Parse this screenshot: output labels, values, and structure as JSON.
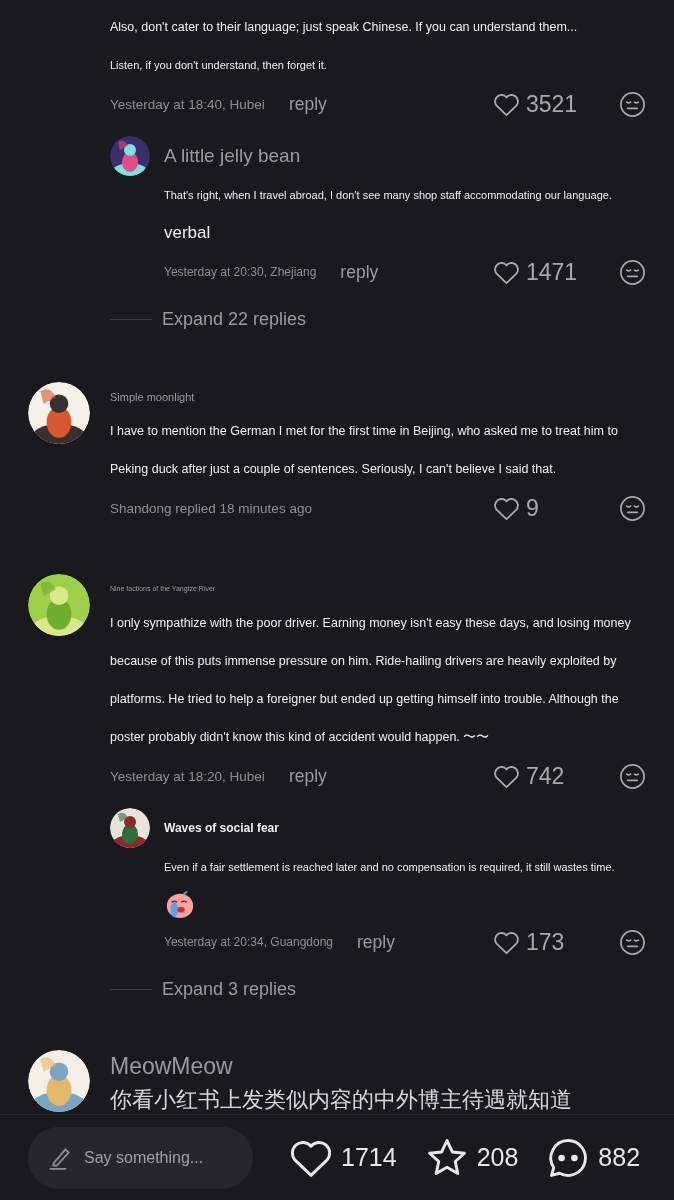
{
  "comments": [
    {
      "paragraphs": [
        {
          "kind": "body",
          "text": "Also, don't cater to their language; just speak Chinese. If you can understand them..."
        },
        {
          "kind": "small",
          "text": "Listen, if you don't understand, then forget it."
        }
      ],
      "meta": {
        "time": "Yesterday at 18:40, Hubei",
        "reply": "reply",
        "likes": "3521"
      },
      "replies": [
        {
          "name": {
            "kind": "large",
            "text": "A little jelly bean"
          },
          "avatar": true,
          "paragraphs": [
            {
              "kind": "small",
              "text": "That's right, when I travel abroad, I don't see many shop staff accommodating our language."
            },
            {
              "kind": "large",
              "text": "verbal"
            }
          ],
          "meta": {
            "time": "Yesterday at 20:30, Zhejiang",
            "reply": "reply",
            "likes": "1471"
          }
        }
      ],
      "expand": "Expand 22 replies"
    },
    {
      "name": {
        "kind": "small",
        "text": "Simple moonlight"
      },
      "avatar": true,
      "paragraphs": [
        {
          "kind": "body",
          "text": "I have to mention the German I met for the first time in Beijing, who asked me to treat him to Peking duck after just a couple of sentences. Seriously, I can't believe I said that."
        }
      ],
      "meta": {
        "time": "Shandong replied 18 minutes ago",
        "likes": "9"
      }
    },
    {
      "name": {
        "kind": "tiny",
        "text": "Nine factions of the Yangtze River"
      },
      "avatar": true,
      "paragraphs": [
        {
          "kind": "body",
          "text": "I only sympathize with the poor driver. Earning money isn't easy these days, and losing money because of this puts immense pressure on him. Ride-hailing drivers are heavily exploited by platforms. He tried to help a foreigner but ended up getting himself into trouble. Although the poster probably didn't know this kind of accident would happen.  〜〜"
        }
      ],
      "meta": {
        "time": "Yesterday at 18:20, Hubei",
        "reply": "reply",
        "likes": "742"
      },
      "replies": [
        {
          "name": {
            "kind": "bold",
            "text": "Waves of social fear"
          },
          "avatar": true,
          "paragraphs": [
            {
              "kind": "small",
              "text": "Even if a fair settlement is reached later and no compensation is required, it still wastes time."
            }
          ],
          "sticker": true,
          "meta": {
            "time": "Yesterday at 20:34, Guangdong",
            "reply": "reply",
            "likes": "173"
          }
        }
      ],
      "expand": "Expand 3 replies"
    },
    {
      "name": {
        "kind": "huge",
        "text": "MeowMeow"
      },
      "avatar": true,
      "paragraphs": [
        {
          "kind": "cjk",
          "text": "你看小红书上发类似内容的中外博主待遇就知道"
        }
      ]
    }
  ],
  "bottom_bar": {
    "input": {
      "placeholder": "Say something..."
    },
    "likes": "1714",
    "favorites": "208",
    "comments": "882"
  }
}
